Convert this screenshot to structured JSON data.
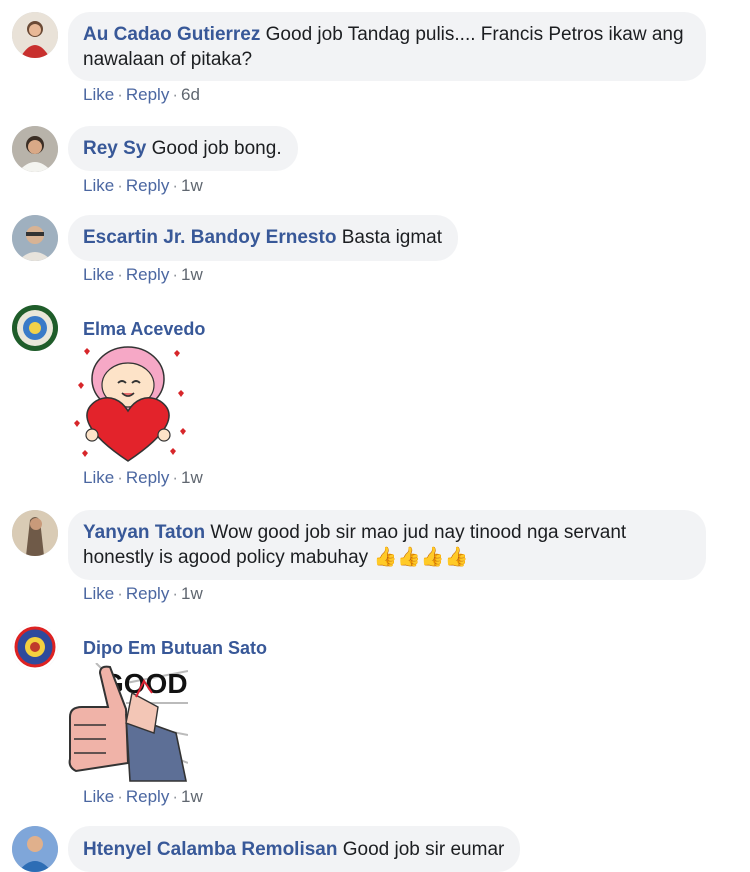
{
  "comments": [
    {
      "author": "Au Cadao Gutierrez",
      "text": "Good job Tandag pulis.... Francis Petros ikaw ang nawalaan of pitaka?",
      "like": "Like",
      "reply": "Reply",
      "time": "6d"
    },
    {
      "author": "Rey Sy",
      "text": "Good job bong.",
      "like": "Like",
      "reply": "Reply",
      "time": "1w"
    },
    {
      "author": "Escartin Jr. Bandoy Ernesto",
      "text": "Basta igmat",
      "like": "Like",
      "reply": "Reply",
      "time": "1w"
    },
    {
      "author": "Elma Acevedo",
      "sticker": "heart-hug-sticker",
      "like": "Like",
      "reply": "Reply",
      "time": "1w"
    },
    {
      "author": "Yanyan Taton",
      "text": "Wow good job sir mao jud nay tinood nga servant honestly is agood policy mabuhay",
      "emoji": "👍👍👍👍",
      "like": "Like",
      "reply": "Reply",
      "time": "1w"
    },
    {
      "author": "Dipo Em Butuan Sato",
      "sticker": "good-thumbs-up-sticker",
      "sticker_text": "GOOD",
      "like": "Like",
      "reply": "Reply",
      "time": "1w"
    },
    {
      "author": "Htenyel Calamba Remolisan",
      "text": "Good job sir eumar"
    }
  ],
  "colors": {
    "author": "#385898",
    "action": "#4b67a1",
    "bubble": "#f2f3f5",
    "meta": "#90949c"
  }
}
